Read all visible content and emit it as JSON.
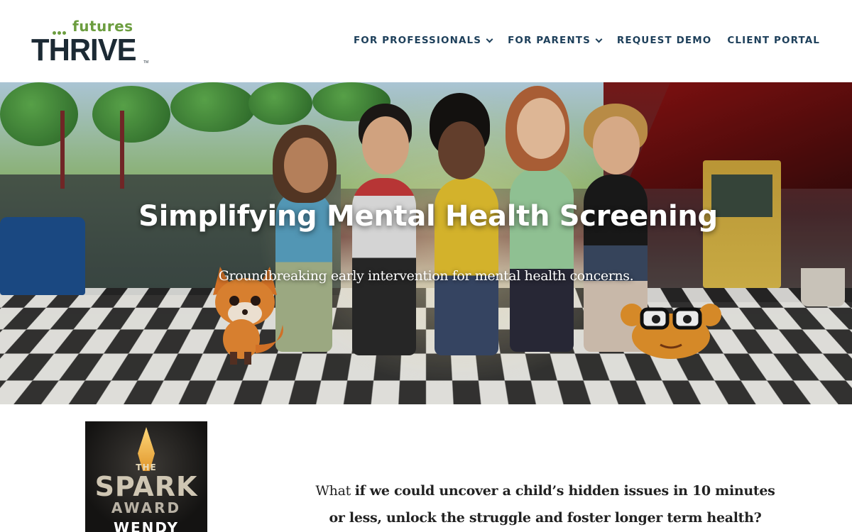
{
  "brand": {
    "logo_top": "futures",
    "logo_main": "THRIVE",
    "logo_tm": "TM",
    "colors": {
      "green": "#6c9d3f",
      "navy": "#1c2a34",
      "nav": "#1d3f5a"
    }
  },
  "nav": {
    "items": [
      {
        "label": "FOR PROFESSIONALS",
        "has_dropdown": true
      },
      {
        "label": "FOR PARENTS",
        "has_dropdown": true
      },
      {
        "label": "REQUEST DEMO",
        "has_dropdown": false
      },
      {
        "label": "CLIENT PORTAL",
        "has_dropdown": false
      }
    ]
  },
  "hero": {
    "title": "Simplifying Mental Health Screening",
    "subtitle": "Groundbreaking early intervention for mental health concerns."
  },
  "award": {
    "the": "THE",
    "spark": "SPARK",
    "award": "AWARD",
    "name": "WENDY"
  },
  "intro": {
    "prefix": "What",
    "bold_text": "if we could uncover a child’s hidden issues in 10 minutes or less, unlock the struggle and foster longer term health?"
  }
}
